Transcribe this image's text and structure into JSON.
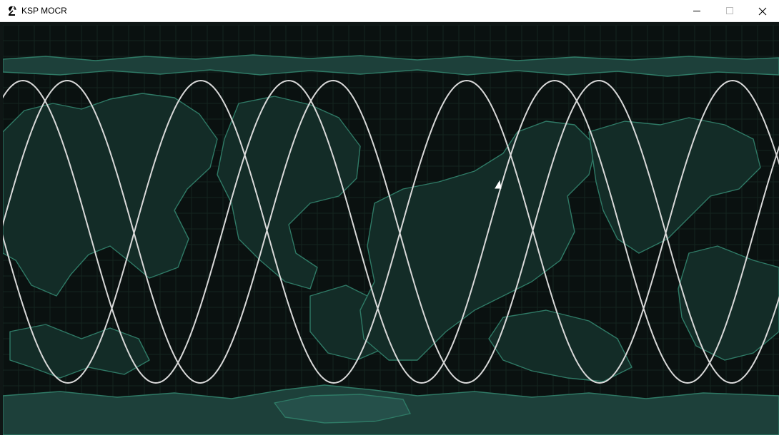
{
  "window": {
    "title": "KSP MOCR",
    "app_icon": "satellite-dish-icon",
    "controls": {
      "minimize_icon": "minimize-icon",
      "maximize_icon": "maximize-icon",
      "close_icon": "close-icon"
    }
  },
  "map": {
    "projection": "equirectangular",
    "grid_lines": true,
    "colors": {
      "background": "#0a1110",
      "land_fill": "#1a3a33",
      "coastline": "#2f7a66",
      "grid": "#183029",
      "ground_track": "#d9d9d9",
      "vessel_marker": "#ffffff"
    },
    "vessel_icon": "vessel-marker-icon"
  }
}
